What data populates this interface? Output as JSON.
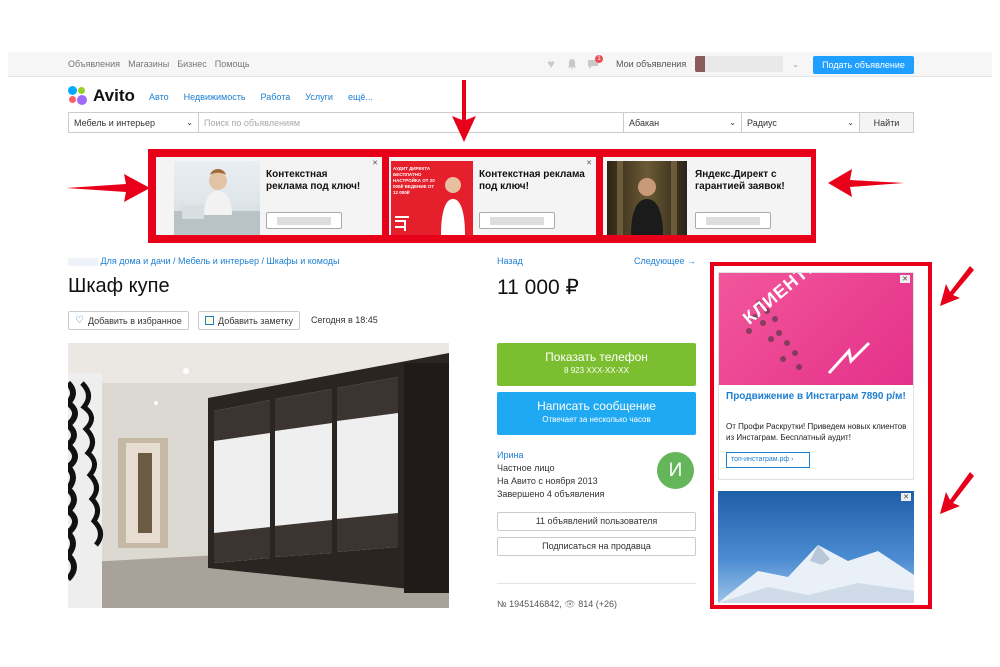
{
  "topbar": {
    "links": [
      "Объявления",
      "Магазины",
      "Бизнес",
      "Помощь"
    ],
    "my_ads": "Мои объявления",
    "notif_count": "1",
    "post_button": "Подать объявление"
  },
  "logo": {
    "text": "Avito"
  },
  "nav": [
    "Авто",
    "Недвижимость",
    "Работа",
    "Услуги",
    "ещё..."
  ],
  "search": {
    "category": "Мебель и интерьер",
    "placeholder": "Поиск по объявлениям",
    "city": "Абакан",
    "radius": "Радиус",
    "button": "Найти"
  },
  "top_ads": [
    {
      "title": "Контекстная реклама под ключ!",
      "image_caption": ""
    },
    {
      "title": "Контекстная реклама под ключ!",
      "image_caption": "АУДИТ ДИРЕКТА БЕСПЛАТНО НАСТРОЙКА ОТ 20 000₽ ВЕДЕНИЕ ОТ 12 000₽"
    },
    {
      "title": "Яндекс.Директ с гарантией заявок!",
      "image_caption": ""
    }
  ],
  "breadcrumb": "Для дома и дачи / Мебель и интерьер / Шкафы и комоды",
  "nav_back": "Назад",
  "nav_next": "Следующее →",
  "listing": {
    "title": "Шкаф купе",
    "price": "11 000 ₽",
    "fav_label": "Добавить в избранное",
    "note_label": "Добавить заметку",
    "date": "Сегодня в 18:45"
  },
  "contact": {
    "phone_label": "Показать телефон",
    "phone_number": "8 923 XXX-XX-XX",
    "message_label": "Написать сообщение",
    "message_sub": "Отвечает за несколько часов"
  },
  "seller": {
    "name": "Ирина",
    "type": "Частное лицо",
    "since": "На Авито с ноября 2013",
    "completed": "Завершено 4 объявления",
    "avatar_letter": "И",
    "ads_button": "11 объявлений пользователя",
    "subscribe_button": "Подписаться на продавца"
  },
  "meta": {
    "id": "№ 1945146842,",
    "views": "814 (+26)"
  },
  "side_ad": {
    "banner_text": "КЛИЕНТЫ И... M, FACEBOOK,",
    "title": "Продвижение в Инстаграм 7890 р/м!",
    "text": "От Профи Раскрутки! Приведем новых клиентов из Инстаграм. Бесплатный аудит!",
    "link": "топ-инстаграм.рф ›"
  },
  "colors": {
    "accent": "#1f9fff",
    "highlight": "#e8001a",
    "phone_button": "#7bbf30",
    "message_button": "#1fa9f2",
    "link": "#1d7fd1"
  }
}
